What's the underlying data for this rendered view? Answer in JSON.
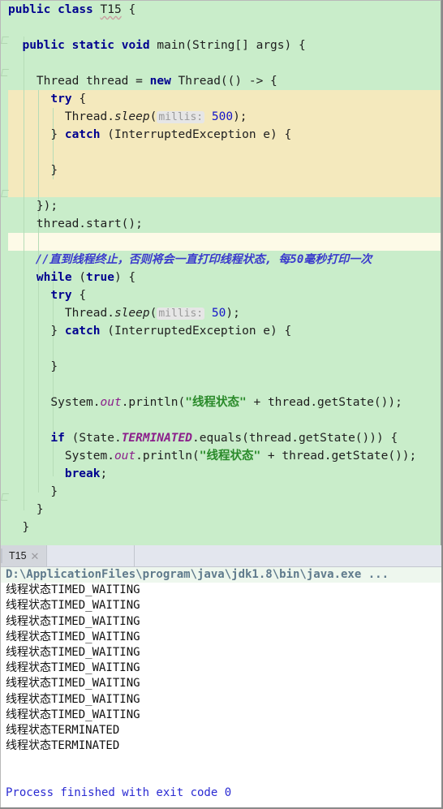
{
  "editor": {
    "background_color": "#c9edca",
    "highlight_lambda_color": "#f4e9bd",
    "highlight_comment_color": "#fdfae7",
    "lines": [
      {
        "id": "l1",
        "text": "public class T15 {"
      },
      {
        "id": "l2",
        "text": ""
      },
      {
        "id": "l3",
        "text": "  public static void main(String[] args) {"
      },
      {
        "id": "l4",
        "text": ""
      },
      {
        "id": "l5",
        "text": "    Thread thread = new Thread(() -> {"
      },
      {
        "id": "l6",
        "text": "      try {"
      },
      {
        "id": "l7",
        "text": "        Thread.sleep( millis: 500);"
      },
      {
        "id": "l8",
        "text": "      } catch (InterruptedException e) {"
      },
      {
        "id": "l9",
        "text": ""
      },
      {
        "id": "l10",
        "text": "      }"
      },
      {
        "id": "l11",
        "text": ""
      },
      {
        "id": "l12",
        "text": "    });"
      },
      {
        "id": "l13",
        "text": "    thread.start();"
      },
      {
        "id": "l14",
        "text": ""
      },
      {
        "id": "l15",
        "text": "    //直到线程终止，否则将会一直打印线程状态, 每50毫秒打印一次"
      },
      {
        "id": "l16",
        "text": "    while (true) {"
      },
      {
        "id": "l17",
        "text": "      try {"
      },
      {
        "id": "l18",
        "text": "        Thread.sleep( millis: 50);"
      },
      {
        "id": "l19",
        "text": "      } catch (InterruptedException e) {"
      },
      {
        "id": "l20",
        "text": ""
      },
      {
        "id": "l21",
        "text": "      }"
      },
      {
        "id": "l22",
        "text": ""
      },
      {
        "id": "l23",
        "text": "      System.out.println(\"线程状态\" + thread.getState());"
      },
      {
        "id": "l24",
        "text": ""
      },
      {
        "id": "l25",
        "text": "      if (State.TERMINATED.equals(thread.getState())) {"
      },
      {
        "id": "l26",
        "text": "        System.out.println(\"线程状态\" + thread.getState());"
      },
      {
        "id": "l27",
        "text": "        break;"
      },
      {
        "id": "l28",
        "text": "      }"
      },
      {
        "id": "l29",
        "text": "    }"
      },
      {
        "id": "l30",
        "text": "  }"
      },
      {
        "id": "l31",
        "text": ""
      },
      {
        "id": "l32",
        "text": "}"
      }
    ],
    "tokens": {
      "kw_public": "public",
      "kw_class": "class",
      "kw_static": "static",
      "kw_void": "void",
      "kw_new": "new",
      "kw_try": "try",
      "kw_catch": "catch",
      "kw_while": "while",
      "kw_true": "true",
      "kw_if": "if",
      "kw_break": "break",
      "type_name": "T15",
      "method_main": "main",
      "param_args": "String[] args",
      "type_thread": "Thread",
      "var_thread": "thread",
      "method_sleep": "sleep",
      "hint_millis": "millis:",
      "num_500": "500",
      "num_50": "50",
      "exception": "InterruptedException",
      "var_e": "e",
      "sys": "System",
      "out": "out",
      "println": "println",
      "str_state": "\"线程状态\"",
      "call_getstate": "thread.getState()",
      "state_enum": "State",
      "terminated": "TERMINATED",
      "equals": "equals",
      "method_start": "thread.start()",
      "comment": "//直到线程终止，否则将会一直打印线程状态, 每50毫秒打印一次"
    }
  },
  "console": {
    "tab_label": "T15",
    "tab_close_icon": "close-icon",
    "command_line": "D:\\ApplicationFiles\\program\\java\\jdk1.8\\bin\\java.exe ...",
    "output_lines": [
      {
        "cn": "线程状态",
        "state": "TIMED_WAITING"
      },
      {
        "cn": "线程状态",
        "state": "TIMED_WAITING"
      },
      {
        "cn": "线程状态",
        "state": "TIMED_WAITING"
      },
      {
        "cn": "线程状态",
        "state": "TIMED_WAITING"
      },
      {
        "cn": "线程状态",
        "state": "TIMED_WAITING"
      },
      {
        "cn": "线程状态",
        "state": "TIMED_WAITING"
      },
      {
        "cn": "线程状态",
        "state": "TIMED_WAITING"
      },
      {
        "cn": "线程状态",
        "state": "TIMED_WAITING"
      },
      {
        "cn": "线程状态",
        "state": "TIMED_WAITING"
      },
      {
        "cn": "线程状态",
        "state": "TERMINATED"
      },
      {
        "cn": "线程状态",
        "state": "TERMINATED"
      }
    ],
    "exit_message": "Process finished with exit code 0",
    "exit_message_color": "#2a2ad2"
  }
}
